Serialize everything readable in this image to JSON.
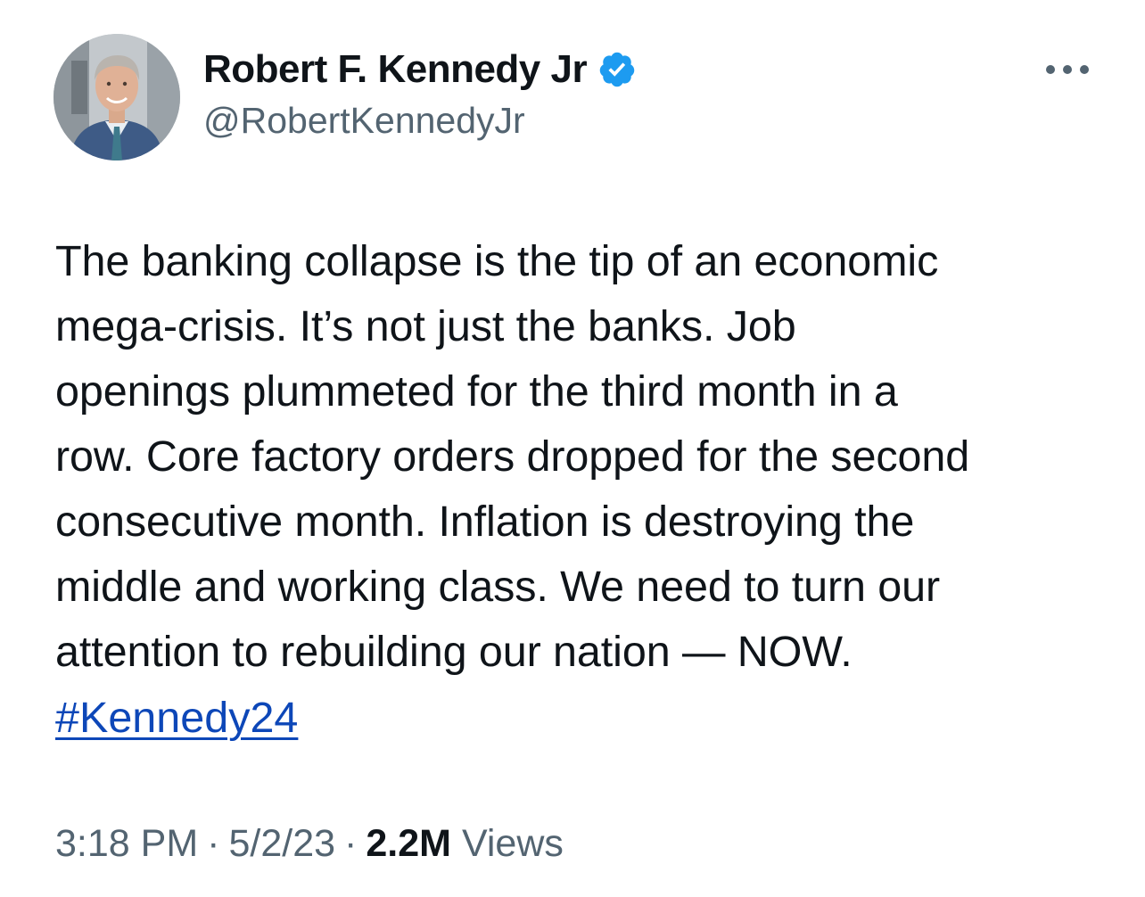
{
  "author": {
    "name": "Robert F. Kennedy Jr",
    "handle": "@RobertKennedyJr",
    "verified": true,
    "verified_color": "#1d9bf0"
  },
  "more_icon": "more-horizontal-icon",
  "tweet": {
    "text": "The banking collapse is the tip of an economic\nmega-crisis. It’s not just the banks. Job\nopenings plummeted for the third month in a\nrow. Core factory orders dropped for the second\nconsecutive month. Inflation is destroying the\nmiddle and working class. We need to turn our\nattention to rebuilding our nation — NOW.",
    "hashtag": "#Kennedy24",
    "hashtag_color": "#0d47b8"
  },
  "meta": {
    "time": "3:18 PM",
    "separator": "·",
    "date": "5/2/23",
    "views_count": "2.2M",
    "views_label": "Views"
  }
}
